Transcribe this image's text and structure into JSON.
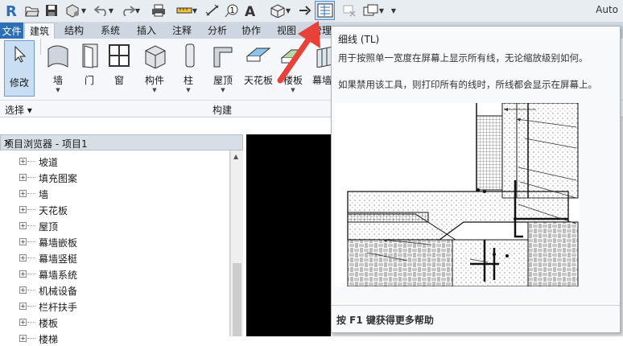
{
  "app": {
    "title": "Auto"
  },
  "tabs": {
    "file": "文件",
    "items": [
      "建筑",
      "结构",
      "系统",
      "插入",
      "注释",
      "分析",
      "协作",
      "视图",
      "管理"
    ]
  },
  "ribbon": {
    "modify": "修改",
    "tools": [
      "墙",
      "门",
      "窗",
      "构件",
      "柱",
      "屋顶",
      "天花板",
      "楼板",
      "幕墙系统"
    ],
    "panels": {
      "select": "选择 ▾",
      "build": "构建"
    }
  },
  "browser": {
    "title": "项目浏览器 - 项目1",
    "close": "×",
    "items": [
      "坡道",
      "填充图案",
      "墙",
      "天花板",
      "屋顶",
      "幕墙嵌板",
      "幕墙竖梃",
      "幕墙系统",
      "机械设备",
      "栏杆扶手",
      "楼板",
      "楼梯"
    ]
  },
  "tooltip": {
    "title": "细线 (TL)",
    "line1": "用于按照单一宽度在屏幕上显示所有线，无论缩放级别如何。",
    "line2": "如果禁用该工具，则打印所有的线时，所线都会显示在屏幕上。",
    "help": "按 F1 键获得更多帮助"
  },
  "colors": {
    "accent": "#2d6fb6",
    "arrow": "#e8413a",
    "active_tool": "#c9def3"
  },
  "icons": [
    "revit-logo-icon",
    "open-icon",
    "save-icon",
    "sync-icon",
    "undo-icon",
    "redo-icon",
    "print-icon",
    "measure-icon",
    "dimension-icon",
    "tag-icon",
    "text-icon",
    "3d-view-icon",
    "section-icon",
    "thin-lines-icon",
    "close-hidden-icon",
    "switch-windows-icon"
  ]
}
